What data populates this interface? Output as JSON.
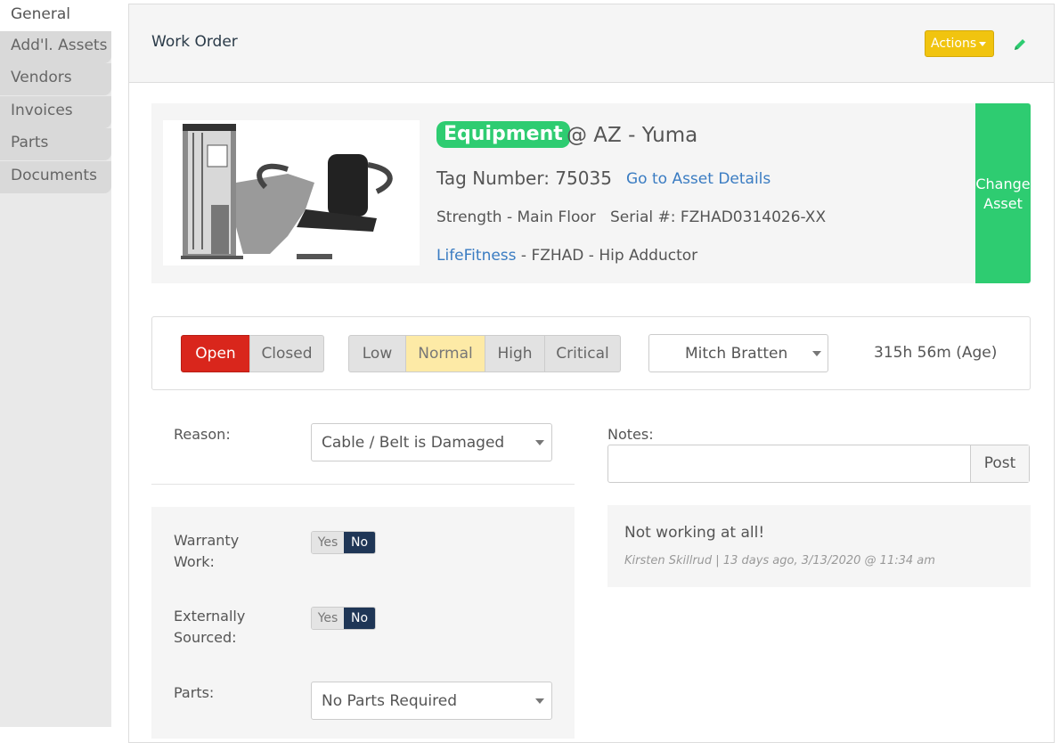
{
  "sidebar": {
    "tabs": [
      {
        "label": "General",
        "active": true
      },
      {
        "label": "Add'l. Assets"
      },
      {
        "label": "Vendors"
      },
      {
        "label": "Invoices"
      },
      {
        "label": "Parts"
      },
      {
        "label": "Documents"
      }
    ]
  },
  "header": {
    "title": "Work Order",
    "actions_label": "Actions",
    "edit_icon": "pencil-icon"
  },
  "asset": {
    "category": "Equipment",
    "location": "@ AZ - Yuma",
    "tag_number": "Tag Number: 75035",
    "details_link": "Go to Asset Details",
    "area": "Strength - Main Floor",
    "serial": "Serial #: FZHAD0314026-XX",
    "brand": "LifeFitness",
    "model": "- FZHAD - Hip Adductor",
    "change_button": "Change Asset",
    "image": "equipment-photo"
  },
  "status": {
    "state_options": [
      "Open",
      "Closed"
    ],
    "state_selected": "Open",
    "priority_options": [
      "Low",
      "Normal",
      "High",
      "Critical"
    ],
    "priority_selected": "Normal",
    "assignee": "Mitch Bratten",
    "age": "315h 56m (Age)"
  },
  "form": {
    "reason_label": "Reason:",
    "reason_value": "Cable / Belt is Damaged",
    "warranty_label": "Warranty Work:",
    "warranty_yes": "Yes",
    "warranty_no": "No",
    "warranty_value": "No",
    "external_label": "Externally Sourced:",
    "external_yes": "Yes",
    "external_no": "No",
    "external_value": "No",
    "parts_label": "Parts:",
    "parts_value": "No Parts Required"
  },
  "notes": {
    "label": "Notes:",
    "input_value": "",
    "post_label": "Post",
    "entries": [
      {
        "text": "Not working at all!",
        "meta": "Kirsten Skillrud  |  13 days ago, 3/13/2020 @ 11:34 am"
      }
    ]
  },
  "colors": {
    "green": "#2ecc71",
    "open_red": "#d9261c",
    "normal_yellow": "#fdeaa6",
    "actions_yellow": "#f1c40f",
    "link_blue": "#3a7cc2",
    "toggle_navy": "#1f3656"
  }
}
